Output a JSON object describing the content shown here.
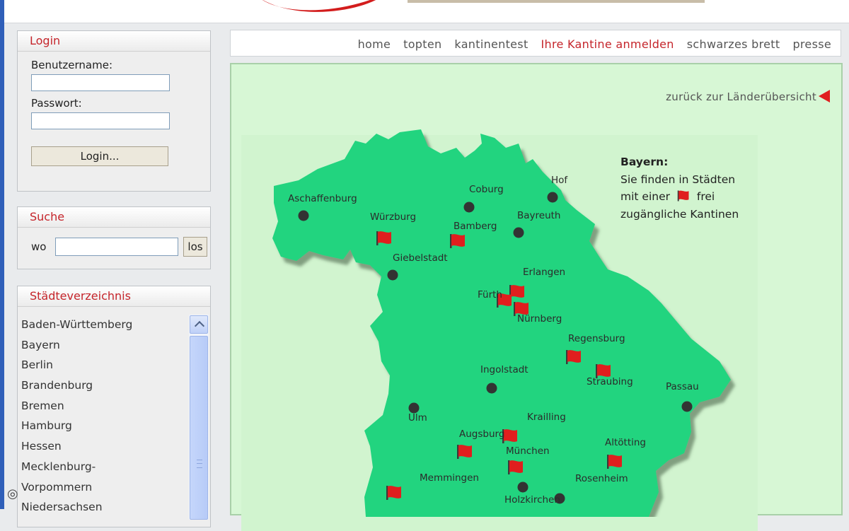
{
  "sidebar": {
    "login": {
      "title": "Login",
      "username_label": "Benutzername:",
      "username_value": "",
      "password_label": "Passwort:",
      "password_value": "",
      "button_label": "Login..."
    },
    "search": {
      "title": "Suche",
      "label": "wo",
      "value": "",
      "button_label": "los"
    },
    "directory": {
      "title": "Städteverzeichnis",
      "items": [
        "Baden-Württemberg",
        "Bayern",
        "Berlin",
        "Brandenburg",
        "Bremen",
        "Hamburg",
        "Hessen",
        "Mecklenburg-",
        "Vorpommern",
        "Niedersachsen"
      ]
    }
  },
  "nav": {
    "items": [
      "home",
      "topten",
      "kantinentest",
      "Ihre Kantine anmelden",
      "schwarzes brett",
      "presse"
    ],
    "active": "Ihre Kantine anmelden"
  },
  "main": {
    "back_link": "zurück zur Länderübersicht",
    "legend": {
      "title": "Bayern:",
      "line1": "Sie finden in Städten",
      "line2_a": "mit einer",
      "line2_b": "frei",
      "line3": "zugängliche Kantinen"
    },
    "cities": [
      {
        "name": "Aschaffenburg",
        "marker": "dot"
      },
      {
        "name": "Würzburg",
        "marker": "flag"
      },
      {
        "name": "Coburg",
        "marker": "dot"
      },
      {
        "name": "Hof",
        "marker": "dot"
      },
      {
        "name": "Bamberg",
        "marker": "flag"
      },
      {
        "name": "Bayreuth",
        "marker": "dot"
      },
      {
        "name": "Giebelstadt",
        "marker": "dot"
      },
      {
        "name": "Erlangen",
        "marker": "flag"
      },
      {
        "name": "Fürth",
        "marker": "flag"
      },
      {
        "name": "Nürnberg",
        "marker": "flag"
      },
      {
        "name": "Regensburg",
        "marker": "flag"
      },
      {
        "name": "Straubing",
        "marker": "flag"
      },
      {
        "name": "Ingolstadt",
        "marker": "dot"
      },
      {
        "name": "Passau",
        "marker": "dot"
      },
      {
        "name": "Ulm",
        "marker": "dot"
      },
      {
        "name": "Krailling",
        "marker": "flag"
      },
      {
        "name": "Augsburg",
        "marker": "flag"
      },
      {
        "name": "München",
        "marker": "flag"
      },
      {
        "name": "Altötting",
        "marker": "flag"
      },
      {
        "name": "Memmingen",
        "marker": "flag"
      },
      {
        "name": "Rosenheim",
        "marker": "dot"
      },
      {
        "name": "Holzkirchen",
        "marker": "dot"
      }
    ]
  },
  "colors": {
    "accent": "#c5252b",
    "map_fill": "#22d47f",
    "map_bg": "#d7f7d5",
    "flag": "#e01e1e"
  }
}
